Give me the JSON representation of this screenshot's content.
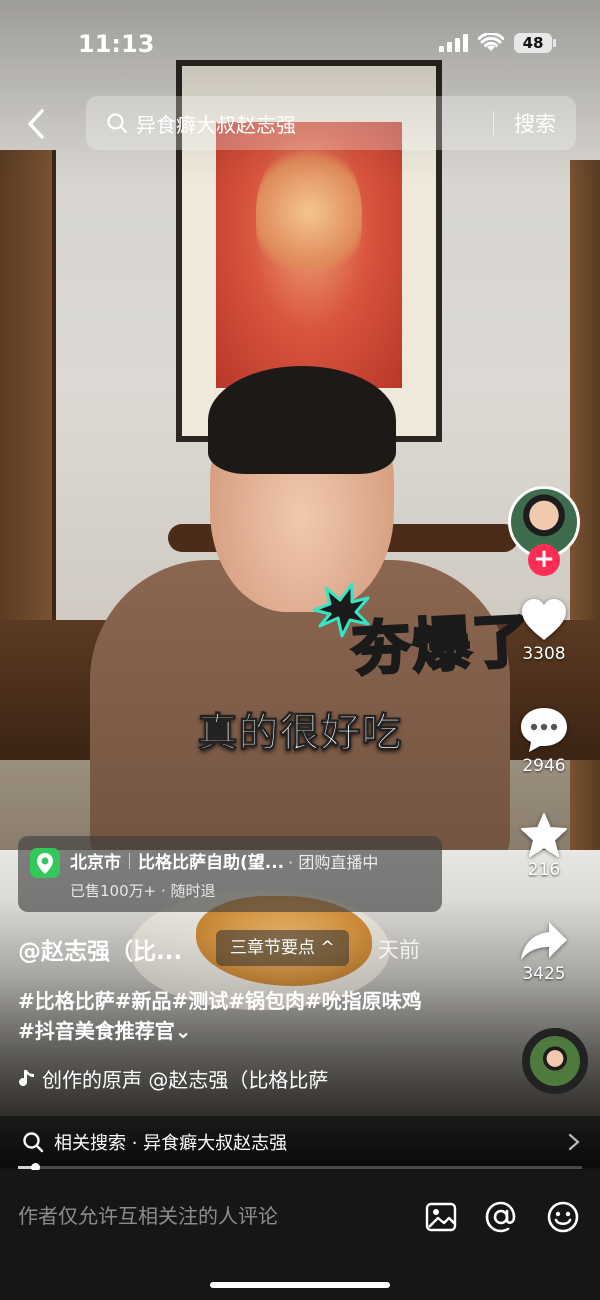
{
  "status_bar": {
    "time": "11:13",
    "battery": "48"
  },
  "search": {
    "query": "异食癖大叔赵志强",
    "submit_label": "搜索"
  },
  "overlay": {
    "sticker_text": "夯爆了",
    "subtitle": "真的很好吃"
  },
  "actions": {
    "likes": "3308",
    "comments": "2946",
    "favorites": "216",
    "shares": "3425",
    "follow_symbol": "+"
  },
  "poi": {
    "city": "北京市",
    "name": "比格比萨自助(望...",
    "tag": "· 团购直播中",
    "sub": "已售100万+ · 随时退"
  },
  "post": {
    "author": "@赵志强（比...",
    "chapter_label": "三章节要点 ^",
    "time": "天前",
    "hashtags_line1": "#比格比萨#新品#测试#锅包肉#吮指原味鸡",
    "hashtags_line2": "#抖音美食推荐官⌄",
    "music": "创作的原声  @赵志强（比格比萨"
  },
  "related": {
    "text": "相关搜索 · 异食癖大叔赵志强"
  },
  "progress": {
    "fraction": 0.03
  },
  "comment_bar": {
    "placeholder": "作者仅允许互相关注的人评论"
  },
  "colors": {
    "follow_red": "#fe2c55",
    "poi_green": "#34c759",
    "sticker_yellow": "#f8c84a"
  }
}
